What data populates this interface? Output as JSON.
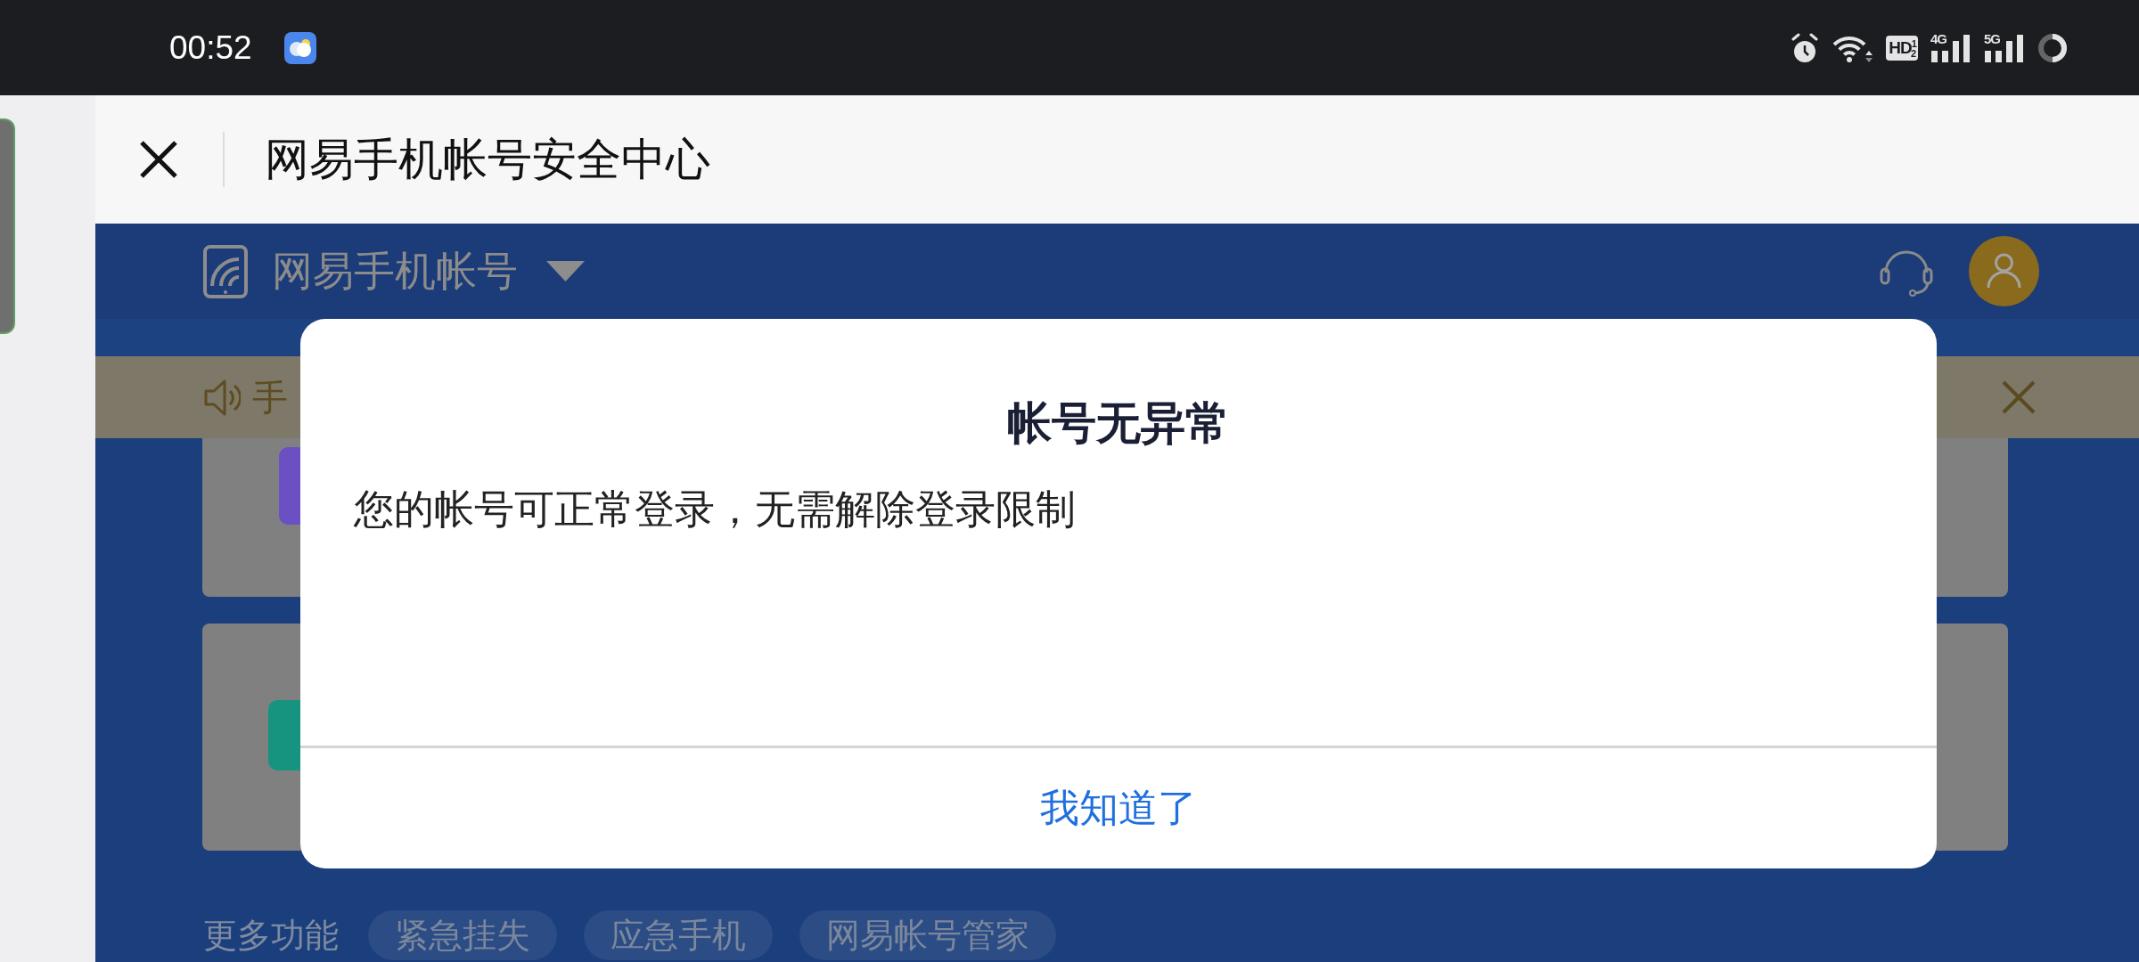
{
  "status_bar": {
    "time": "00:52",
    "hd_badge": "HD$^{1}$$_{2}$",
    "sim_1_network": "4G",
    "sim_2_network": "5G"
  },
  "browser_header": {
    "title": "网易手机帐号安全中心"
  },
  "site_header": {
    "brand": "网易手机帐号"
  },
  "notice_bar": {
    "text": "手"
  },
  "cards": [
    {
      "color": "#6b50c3"
    },
    {
      "color": "#16947f"
    }
  ],
  "more_functions": {
    "label": "更多功能",
    "chips": [
      "紧急挂失",
      "应急手机",
      "网易帐号管家"
    ]
  },
  "dialog": {
    "title": "帐号无异常",
    "message": "您的帐号可正常登录，无需解除登录限制",
    "button": "我知道了"
  }
}
